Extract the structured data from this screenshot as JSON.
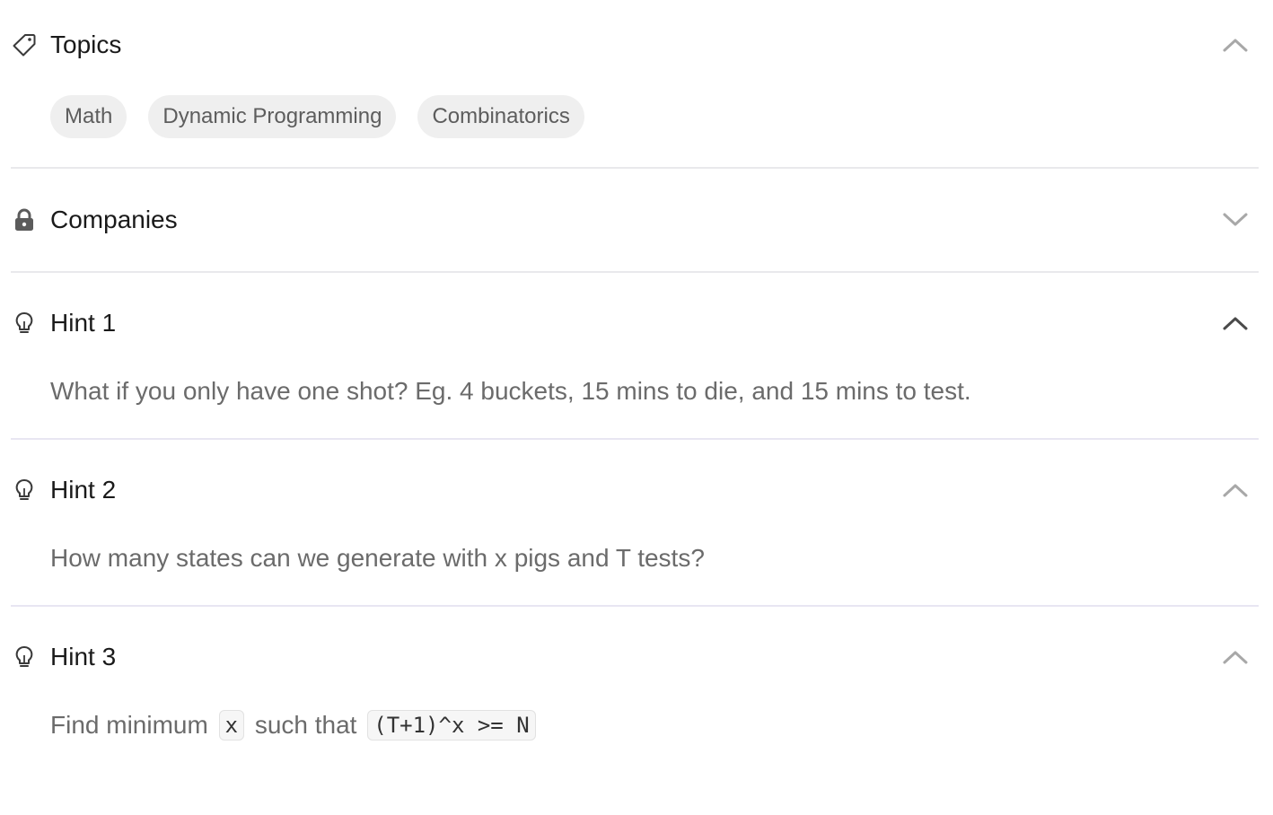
{
  "topics": {
    "title": "Topics",
    "tags": [
      "Math",
      "Dynamic Programming",
      "Combinatorics"
    ]
  },
  "companies": {
    "title": "Companies"
  },
  "hints": [
    {
      "title": "Hint 1",
      "text": "What if you only have one shot? Eg. 4 buckets, 15 mins to die, and 15 mins to test."
    },
    {
      "title": "Hint 2",
      "text": "How many states can we generate with x pigs and T tests?"
    },
    {
      "title": "Hint 3",
      "text_parts": [
        "Find minimum",
        "x",
        "such that",
        "(T+1)^x >= N"
      ]
    }
  ],
  "icons": {
    "topics": "tag-icon",
    "companies": "lock-icon",
    "hint": "lightbulb-icon",
    "expanded": "chevron-up-icon",
    "collapsed": "chevron-down-icon"
  },
  "colors": {
    "tag_bg": "#efefef",
    "hint_text": "#6b6b6b",
    "divider": "#e9e9ec"
  }
}
